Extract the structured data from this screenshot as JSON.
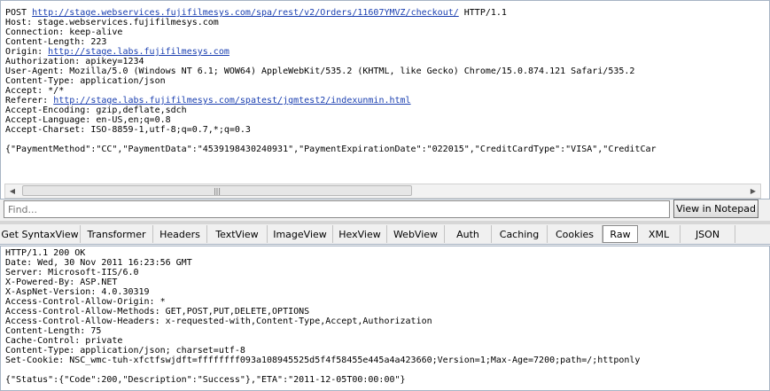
{
  "request": {
    "lines": [
      {
        "parts": [
          {
            "t": "POST "
          },
          {
            "t": "http://stage.webservices.fujifilmesys.com/spa/rest/v2/Orders/11607YMVZ/checkout/",
            "link": true
          },
          {
            "t": " HTTP/1.1"
          }
        ]
      },
      {
        "parts": [
          {
            "t": "Host: stage.webservices.fujifilmesys.com"
          }
        ]
      },
      {
        "parts": [
          {
            "t": "Connection: keep-alive"
          }
        ]
      },
      {
        "parts": [
          {
            "t": "Content-Length: 223"
          }
        ]
      },
      {
        "parts": [
          {
            "t": "Origin: "
          },
          {
            "t": "http://stage.labs.fujifilmesys.com",
            "link": true
          }
        ]
      },
      {
        "parts": [
          {
            "t": "Authorization: apikey=1234"
          }
        ]
      },
      {
        "parts": [
          {
            "t": "User-Agent: Mozilla/5.0 (Windows NT 6.1; WOW64) AppleWebKit/535.2 (KHTML, like Gecko) Chrome/15.0.874.121 Safari/535.2"
          }
        ]
      },
      {
        "parts": [
          {
            "t": "Content-Type: application/json"
          }
        ]
      },
      {
        "parts": [
          {
            "t": "Accept: */*"
          }
        ]
      },
      {
        "parts": [
          {
            "t": "Referer: "
          },
          {
            "t": "http://stage.labs.fujifilmesys.com/spatest/jgmtest2/indexunmin.html",
            "link": true
          }
        ]
      },
      {
        "parts": [
          {
            "t": "Accept-Encoding: gzip,deflate,sdch"
          }
        ]
      },
      {
        "parts": [
          {
            "t": "Accept-Language: en-US,en;q=0.8"
          }
        ]
      },
      {
        "parts": [
          {
            "t": "Accept-Charset: ISO-8859-1,utf-8;q=0.7,*;q=0.3"
          }
        ]
      },
      {
        "parts": [
          {
            "t": ""
          }
        ]
      },
      {
        "parts": [
          {
            "t": "{\"PaymentMethod\":\"CC\",\"PaymentData\":\"4539198430240931\",\"PaymentExpirationDate\":\"022015\",\"CreditCardType\":\"VISA\",\"CreditCar"
          }
        ]
      }
    ]
  },
  "find": {
    "placeholder": "Find..."
  },
  "view_in_notepad": "View in Notepad",
  "tabs": [
    {
      "label": "Get SyntaxView"
    },
    {
      "label": "Transformer"
    },
    {
      "label": "Headers"
    },
    {
      "label": "TextView"
    },
    {
      "label": "ImageView"
    },
    {
      "label": "HexView"
    },
    {
      "label": "WebView"
    },
    {
      "label": "Auth"
    },
    {
      "label": "Caching"
    },
    {
      "label": "Cookies"
    },
    {
      "label": "Raw",
      "selected": true
    },
    {
      "label": "XML"
    },
    {
      "label": "JSON"
    }
  ],
  "response": {
    "lines": [
      "HTTP/1.1 200 OK",
      "Date: Wed, 30 Nov 2011 16:23:56 GMT",
      "Server: Microsoft-IIS/6.0",
      "X-Powered-By: ASP.NET",
      "X-AspNet-Version: 4.0.30319",
      "Access-Control-Allow-Origin: *",
      "Access-Control-Allow-Methods: GET,POST,PUT,DELETE,OPTIONS",
      "Access-Control-Allow-Headers: x-requested-with,Content-Type,Accept,Authorization",
      "Content-Length: 75",
      "Cache-Control: private",
      "Content-Type: application/json; charset=utf-8",
      "Set-Cookie: NSC_wmc-tuh-xfctfswjdft=ffffffff093a108945525d5f4f58455e445a4a423660;Version=1;Max-Age=7200;path=/;httponly",
      "",
      "{\"Status\":{\"Code\":200,\"Description\":\"Success\"},\"ETA\":\"2011-12-05T00:00:00\"}"
    ]
  }
}
